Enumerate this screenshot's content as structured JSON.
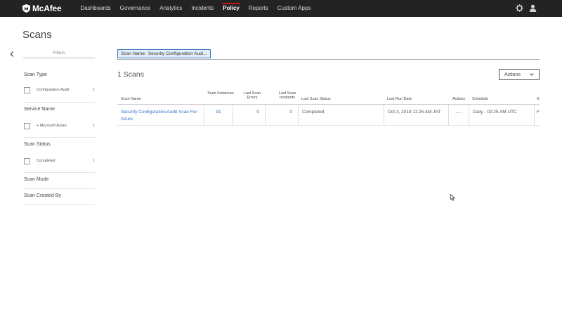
{
  "header": {
    "brand": "McAfee",
    "nav": [
      {
        "label": "Dashboards",
        "active": false
      },
      {
        "label": "Governance",
        "active": false
      },
      {
        "label": "Analytics",
        "active": false
      },
      {
        "label": "Incidents",
        "active": false
      },
      {
        "label": "Policy",
        "active": true
      },
      {
        "label": "Reports",
        "active": false
      },
      {
        "label": "Custom Apps",
        "active": false
      }
    ],
    "icons": [
      "gear-icon",
      "user-icon"
    ]
  },
  "page": {
    "title": "Scans"
  },
  "filters": {
    "label": "Filters",
    "groups": [
      {
        "title": "Scan Type",
        "options": [
          {
            "label": "Configuration Audit",
            "count": "1"
          }
        ]
      },
      {
        "title": "Service Name",
        "options": [
          {
            "label": "+ Microsoft Azure",
            "count": "1"
          }
        ]
      },
      {
        "title": "Scan Status",
        "options": [
          {
            "label": "Completed",
            "count": "1"
          }
        ]
      },
      {
        "title": "Scan Mode",
        "options": []
      },
      {
        "title": "Scan Created By",
        "options": []
      }
    ]
  },
  "active_filter": {
    "key": "Scan Name:",
    "value": "Security Configuration Audi..."
  },
  "results": {
    "count_text": "1 Scans",
    "actions_label": "Actions"
  },
  "table": {
    "columns": [
      "Scan Name",
      "Scan Instances",
      "Last Scan Errors",
      "Last Scan Incidents",
      "Last Scan Status",
      "Last Run Date",
      "Actions",
      "Schedule",
      "S"
    ],
    "rows": [
      {
        "scan_name": "Security Configuration Audit Scan For Azure",
        "instances": "91",
        "errors": "0",
        "incidents": "0",
        "status": "Completed",
        "last_run": "Oct 3, 2019 11:25 AM JST",
        "actions": "···",
        "schedule": "Daily - 02:25 AM UTC",
        "extra": "F"
      }
    ]
  },
  "colors": {
    "topbar": "#232323",
    "active_underline": "#c01818",
    "link": "#2f6fc4",
    "chip_bg": "#e3eefa",
    "chip_border": "#3a78c2"
  }
}
